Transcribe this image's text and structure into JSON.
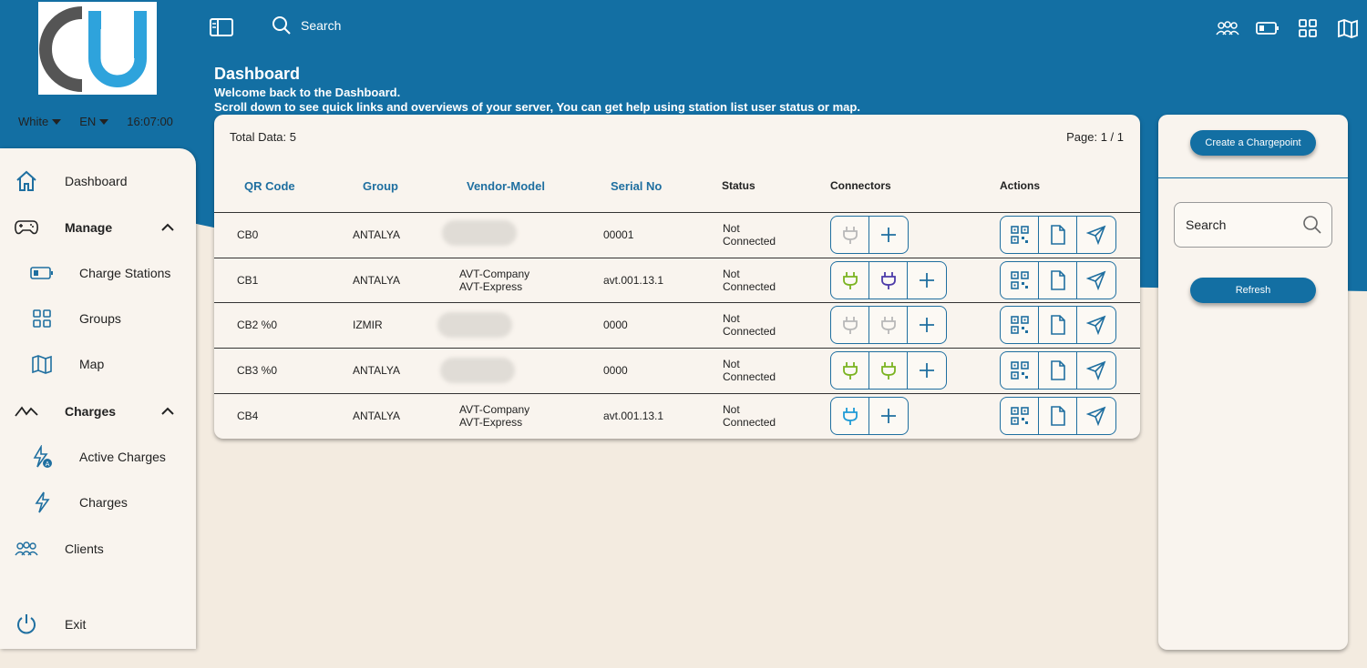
{
  "header": {
    "search_label": "Search",
    "theme": "White",
    "language": "EN",
    "time": "16:07:00",
    "top_icons": [
      "clients-icon",
      "battery-icon",
      "grid-icon",
      "map-icon"
    ]
  },
  "page": {
    "title": "Dashboard",
    "subtitle": "Welcome back to the Dashboard.",
    "description": "Scroll down to see quick links and overviews of your server, You can get help using station list user status or map."
  },
  "sidebar": {
    "items": [
      {
        "label": "Dashboard",
        "icon": "home-icon"
      },
      {
        "label": "Manage",
        "icon": "gamepad-icon"
      },
      {
        "label": "Charge Stations",
        "icon": "battery-icon"
      },
      {
        "label": "Groups",
        "icon": "grid-icon"
      },
      {
        "label": "Map",
        "icon": "map-icon"
      },
      {
        "label": "Charges",
        "icon": "trend-icon"
      },
      {
        "label": "Active Charges",
        "icon": "bolt-a-icon"
      },
      {
        "label": "Charges",
        "icon": "bolt-icon"
      },
      {
        "label": "Clients",
        "icon": "clients-icon"
      },
      {
        "label": "Exit",
        "icon": "power-icon"
      }
    ]
  },
  "table": {
    "total": "Total Data: 5",
    "page": "Page: 1 / 1",
    "headers": {
      "qr": "QR Code",
      "group": "Group",
      "vendor": "Vendor-Model",
      "serial": "Serial No",
      "status": "Status",
      "connectors": "Connectors",
      "actions": "Actions"
    },
    "rows": [
      {
        "qr": "CB0",
        "group": "ANTALYA",
        "vendor1": "",
        "vendor2": "",
        "serial": "00001",
        "status1": "Not",
        "status2": "Connected"
      },
      {
        "qr": "CB1",
        "group": "ANTALYA",
        "vendor1": "AVT-Company",
        "vendor2": "AVT-Express",
        "serial": "avt.001.13.1",
        "status1": "Not",
        "status2": "Connected"
      },
      {
        "qr": "CB2 %0",
        "group": "IZMIR",
        "vendor1": "",
        "vendor2": "",
        "serial": "0000",
        "status1": "Not",
        "status2": "Connected"
      },
      {
        "qr": "CB3 %0",
        "group": "ANTALYA",
        "vendor1": "",
        "vendor2": "",
        "serial": "0000",
        "status1": "Not",
        "status2": "Connected"
      },
      {
        "qr": "CB4",
        "group": "ANTALYA",
        "vendor1": "AVT-Company",
        "vendor2": "AVT-Express",
        "serial": "avt.001.13.1",
        "status1": "Not",
        "status2": "Connected"
      }
    ],
    "connector_colors": {
      "gray": "#b8b8b8",
      "green": "#7ab320",
      "purple": "#4b3aa8",
      "blue": "#1e9ad6"
    }
  },
  "right_panel": {
    "create_label": "Create a Chargepoint",
    "search_placeholder": "Search",
    "refresh_label": "Refresh"
  },
  "colors": {
    "primary": "#136fa3",
    "background": "#f3ebe0",
    "card": "#f9f4ee"
  }
}
